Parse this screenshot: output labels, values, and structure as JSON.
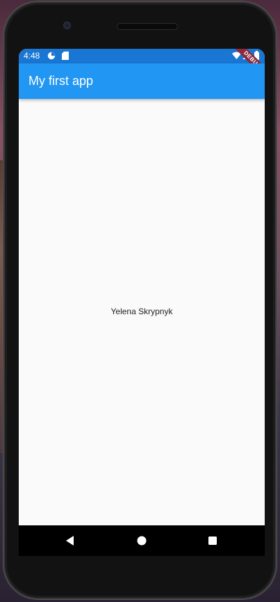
{
  "status_bar": {
    "time": "4:48",
    "icons_left": [
      "data-saver-icon",
      "sd-card-icon"
    ],
    "icons_right": [
      "wifi-icon",
      "signal-icon",
      "battery-icon"
    ]
  },
  "app_bar": {
    "title": "My first app",
    "debug_banner": "DEBUG"
  },
  "body": {
    "text": "Yelena Skrypnyk"
  },
  "nav_bar": {
    "buttons": [
      "back-icon",
      "home-icon",
      "recents-icon"
    ]
  },
  "colors": {
    "status_bar": "#1976d2",
    "app_bar": "#2196f3",
    "background": "#fafafa",
    "debug_banner": "#8b2a3c"
  }
}
